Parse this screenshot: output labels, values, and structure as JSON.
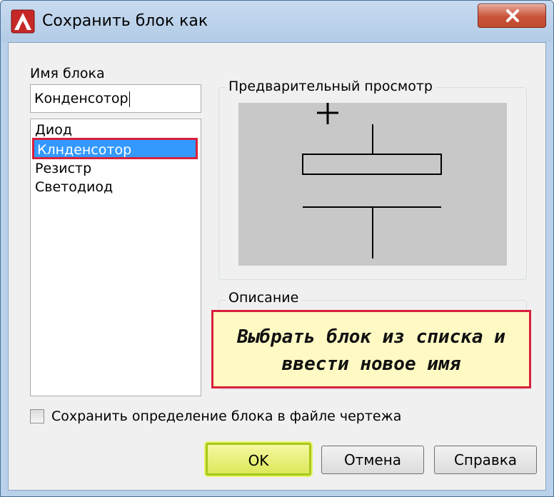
{
  "window": {
    "title": "Сохранить блок как",
    "icon": "autocad-a-icon",
    "close_icon": "close-icon"
  },
  "block_name": {
    "label": "Имя блока",
    "value": "Конденсотор"
  },
  "block_list": {
    "items": [
      {
        "label": "Диод",
        "selected": false
      },
      {
        "label": "Клнденсотор",
        "selected": true
      },
      {
        "label": "Резистр",
        "selected": false
      },
      {
        "label": "Светодиод",
        "selected": false
      }
    ]
  },
  "preview": {
    "label": "Предварительный просмотр"
  },
  "description": {
    "label": "Описание",
    "text_line1": "Выбрать блок из списка и",
    "text_line2": "ввести новое имя"
  },
  "save_definition": {
    "label": "Сохранить определение блока в файле чертежа",
    "checked": false
  },
  "buttons": {
    "ok": "OK",
    "cancel": "Отмена",
    "help": "Справка"
  },
  "colors": {
    "selection": "#3399ff",
    "highlight_border": "#d8203a",
    "ok_highlight": "#dde85a",
    "description_bg": "#fff9c4",
    "preview_bg": "#c8c8c8"
  }
}
